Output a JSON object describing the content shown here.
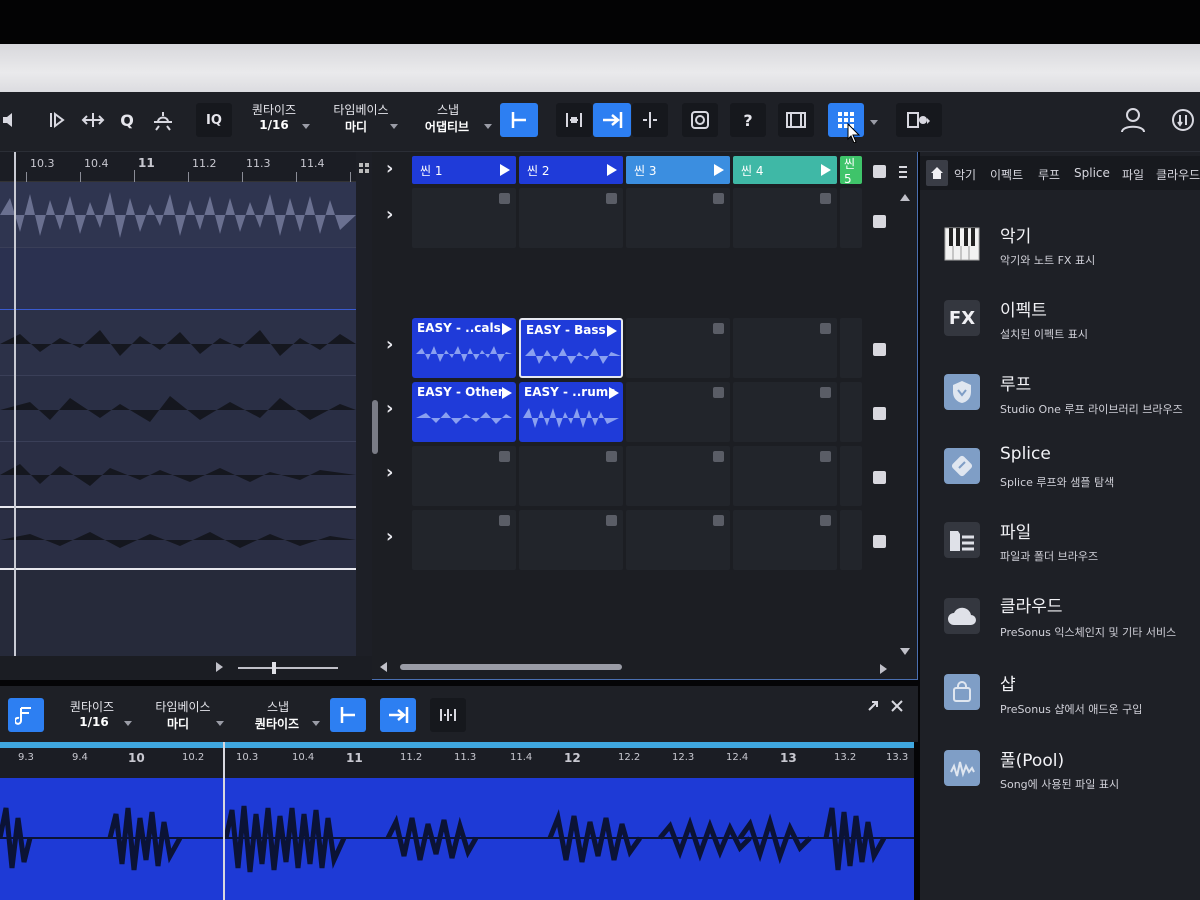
{
  "toolbar": {
    "quantize_label": "퀀타이즈",
    "quantize_value": "1/16",
    "timebase_label": "타임베이스",
    "timebase_value": "마디",
    "snap_label": "스냅",
    "snap_value": "어댑티브",
    "iq_label": "IQ",
    "q_label": "Q",
    "help_label": "?"
  },
  "arrange_ruler": [
    "10.3",
    "10.4",
    "11",
    "11.2",
    "11.3",
    "11.4"
  ],
  "scenes": [
    {
      "label": "씬 1",
      "color": "#1f3bd9"
    },
    {
      "label": "씬 2",
      "color": "#1f3bd9"
    },
    {
      "label": "씬 3",
      "color": "#3b8ee0"
    },
    {
      "label": "씬 4",
      "color": "#3fb8a6"
    },
    {
      "label": "씬 5",
      "color": "#3fc46a"
    }
  ],
  "clips": [
    {
      "title": "EASY - ..cals"
    },
    {
      "title": "EASY - Bass"
    },
    {
      "title": "EASY - Other"
    },
    {
      "title": "EASY - ..rums"
    }
  ],
  "browser": {
    "tabs": [
      "악기",
      "이펙트",
      "루프",
      "Splice",
      "파일",
      "클라우드"
    ],
    "items": [
      {
        "title": "악기",
        "desc": "악기와 노트 FX 표시",
        "icon": "piano-icon"
      },
      {
        "title": "이펙트",
        "desc": "설치된 이펙트 표시",
        "icon": "fx-icon",
        "icon_text": "FX"
      },
      {
        "title": "루프",
        "desc": "Studio One 루프 라이브러리 브라우즈",
        "icon": "loop-shield-icon"
      },
      {
        "title": "Splice",
        "desc": "Splice 루프와 샘플 탐색",
        "icon": "splice-icon"
      },
      {
        "title": "파일",
        "desc": "파일과 폴더 브라우즈",
        "icon": "folder-list-icon"
      },
      {
        "title": "클라우드",
        "desc": "PreSonus 익스체인지 및 기타 서비스",
        "icon": "cloud-icon"
      },
      {
        "title": "샵",
        "desc": "PreSonus 샵에서 애드온 구입",
        "icon": "shop-bag-icon"
      },
      {
        "title": "풀(Pool)",
        "desc": "Song에 사용된 파일 표시",
        "icon": "pool-wave-icon"
      }
    ]
  },
  "editor": {
    "quantize_label": "퀀타이즈",
    "quantize_value": "1/16",
    "timebase_label": "타임베이스",
    "timebase_value": "마디",
    "snap_label": "스냅",
    "snap_value": "퀀타이즈",
    "ruler": [
      "9.3",
      "9.4",
      "10",
      "10.2",
      "10.3",
      "10.4",
      "11",
      "11.2",
      "11.3",
      "11.4",
      "12",
      "12.2",
      "12.3",
      "12.4",
      "13",
      "13.2",
      "13.3"
    ]
  },
  "colors": {
    "accent": "#2d7ff2",
    "clip_blue": "#1f3bd9",
    "editor_blue": "#1e3ad6"
  }
}
